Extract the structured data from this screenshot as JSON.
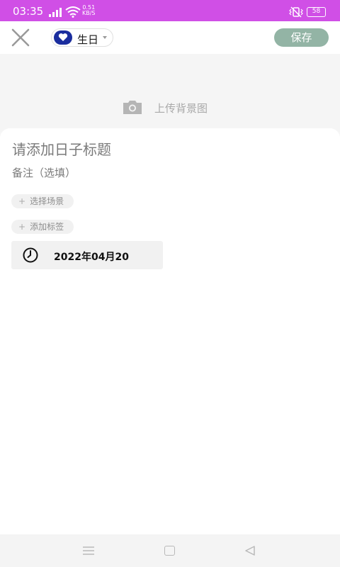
{
  "status_bar": {
    "time": "03:35",
    "net_speed_value": "0.51",
    "net_speed_unit": "KB/S",
    "battery": "58"
  },
  "top_bar": {
    "category_label": "生日",
    "save_label": "保存",
    "colors": {
      "save_bg": "#93b4a5",
      "heart_badge": "#1a2d9e",
      "status_bar": "#d04fe6"
    }
  },
  "background": {
    "upload_label": "上传背景图"
  },
  "form": {
    "title_placeholder": "请添加日子标题",
    "note_placeholder": "备注（选填）",
    "scene_label": "选择场景",
    "tag_label": "添加标签",
    "date": "2022年04月20"
  }
}
